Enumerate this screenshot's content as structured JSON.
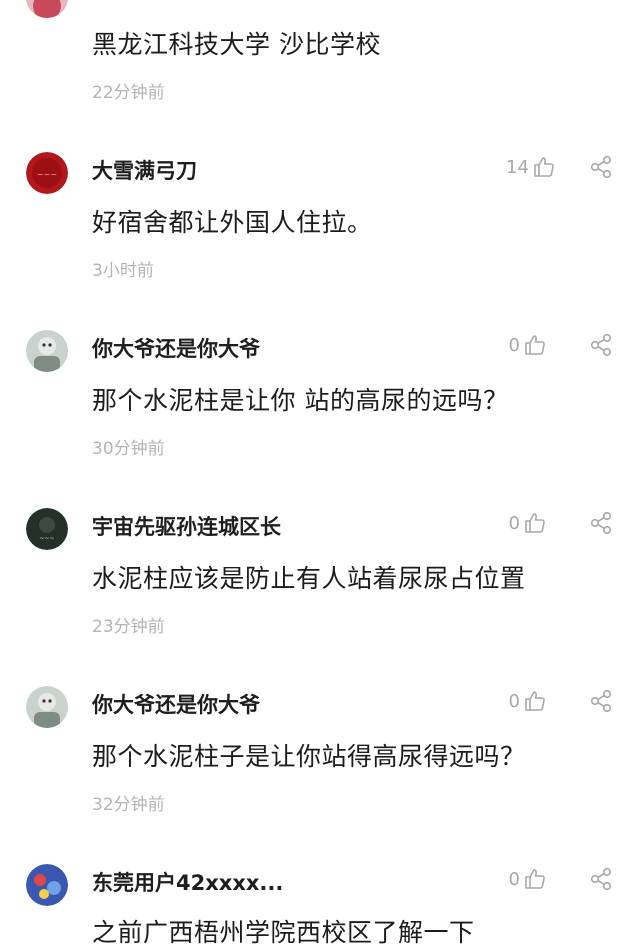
{
  "comments": [
    {
      "username": "",
      "text": "黑龙江科技大学 沙比学校",
      "time": "22分钟前",
      "likes": "",
      "avatar_color": "#c84a5a"
    },
    {
      "username": "大雪满弓刀",
      "text": "好宿舍都让外国人住拉。",
      "time": "3小时前",
      "likes": "14",
      "avatar_color": "#b2171b"
    },
    {
      "username": "你大爷还是你大爷",
      "text": "那个水泥柱是让你 站的高尿的远吗？",
      "time": "30分钟前",
      "likes": "0",
      "avatar_color": "#8a9a8c"
    },
    {
      "username": "宇宙先驱孙连城区长",
      "text": "水泥柱应该是防止有人站着尿尿占位置",
      "time": "23分钟前",
      "likes": "0",
      "avatar_color": "#243028"
    },
    {
      "username": "你大爷还是你大爷",
      "text": "那个水泥柱子是让你站得高尿得远吗？",
      "time": "32分钟前",
      "likes": "0",
      "avatar_color": "#8a9a8c"
    },
    {
      "username": "东莞用户42xxxx...",
      "text": "之前广西梧州学院西校区了解一下",
      "time": "",
      "likes": "0",
      "avatar_color": "#3a58b0"
    }
  ],
  "icons": {
    "like": "thumbs-up-icon",
    "share": "share-icon"
  },
  "colors": {
    "meta_gray": "#b4b4b4",
    "text_dark": "#1c1c1c"
  }
}
